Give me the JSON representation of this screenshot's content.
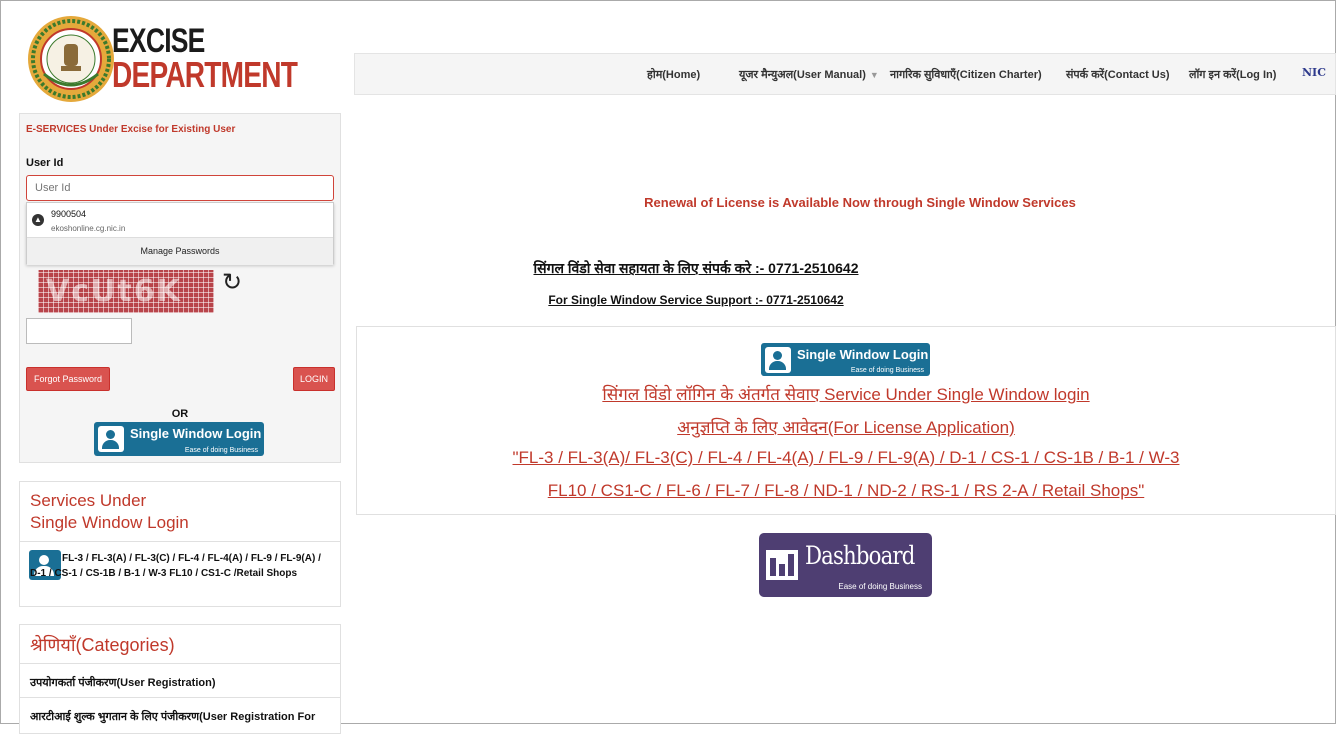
{
  "brand": {
    "line1": "EXCISE",
    "line2": "DEPARTMENT",
    "nic": "NIC"
  },
  "nav": {
    "items": [
      "होम(Home)",
      "यूजर मैन्युअल(User Manual)",
      "नागरिक सुविधाएँ(Citizen Charter)",
      "संपर्क करें(Contact Us)",
      "लॉग इन करें(Log In)"
    ]
  },
  "login": {
    "title": "E-SERVICES Under Excise for Existing User",
    "userid_label": "User Id",
    "userid_placeholder": "User Id",
    "autofill_user": "9900504",
    "autofill_site": "ekoshonline.cg.nic.in",
    "manage_passwords": "Manage Passwords",
    "captcha": "VcUt6K",
    "forgot_password": "Forgot Password",
    "login_button": "LOGIN",
    "or": "OR"
  },
  "single_window_btn": {
    "title": "Single Window Login",
    "subtitle": "Ease of doing Business"
  },
  "services": {
    "title_line1": "Services Under",
    "title_line2": "Single Window Login",
    "text": "FL-3 / FL-3(A) / FL-3(C) / FL-4 / FL-4(A) / FL-9 / FL-9(A) / D-1 / CS-1 / CS-1B / B-1 / W-3 FL10 / CS1-C /Retail Shops"
  },
  "categories": {
    "title": "श्रेणियाँ(Categories)",
    "items": [
      "उपयोगकर्ता पंजीकरण(User Registration)",
      "आरटीआई शुल्क भुगतान के लिए पंजीकरण(User Registration For"
    ]
  },
  "main": {
    "notice": "Renewal of License is Available Now through Single Window Services",
    "support_hindi": "सिंगल विंडो सेवा सहायता के लिए संपर्क करे :- 0771-2510642",
    "support_english": "For Single Window Service Support :- 0771-2510642",
    "sw_line1": "सिंगल विंडो लॉगिन के अंतर्गत सेवाए Service Under Single Window login",
    "sw_line2": "अनुज्ञप्ति के लिए आवेदन(For License Application)",
    "sw_line3": "\"FL-3 / FL-3(A)/ FL-3(C) / FL-4 / FL-4(A) / FL-9 / FL-9(A) / D-1 / CS-1 / CS-1B / B-1 / W-3",
    "sw_line4": "FL10 / CS1-C / FL-6 / FL-7 / FL-8 / ND-1 / ND-2 / RS-1 / RS 2-A / Retail Shops\""
  },
  "dashboard": {
    "title": "Dashboard",
    "subtitle": "Ease of doing Business"
  }
}
